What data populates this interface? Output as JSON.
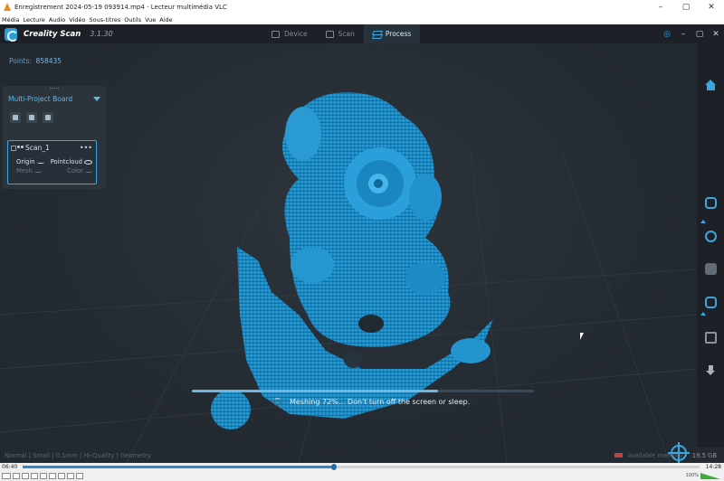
{
  "vlc": {
    "title": "Enregistrement 2024-05-19 093914.mp4 - Lecteur multimédia VLC",
    "menu": [
      "Média",
      "Lecture",
      "Audio",
      "Vidéo",
      "Sous-titres",
      "Outils",
      "Vue",
      "Aide"
    ],
    "time_current": "06:40",
    "time_total": "14:28",
    "seek_progress": 0.46,
    "volume": "100%"
  },
  "app": {
    "name": "Creality Scan",
    "version": "3.1.30",
    "tabs": [
      {
        "label": "Device",
        "active": false
      },
      {
        "label": "Scan",
        "active": false
      },
      {
        "label": "Process",
        "active": true
      }
    ],
    "accent_color": "#3aa7e0"
  },
  "viewport": {
    "points_label": "Points:",
    "points_value": "858435"
  },
  "panel": {
    "title": "Multi-Project Board",
    "scan": {
      "name": "Scan_1",
      "origin": "Origin",
      "pointcloud": "Pointcloud",
      "mesh": "Mesh",
      "color": "Color"
    }
  },
  "progress": {
    "message": "Meshing 72%... Don't turn off the screen or sleep.",
    "percent": 72
  },
  "status": {
    "settings": "Normal | Small | 0.1mm | Hi-Quality | Geometry",
    "memory_label": "Available memory",
    "memory_value": "19.5 GB"
  },
  "icons": {
    "right_toolbar": [
      "home-icon",
      "hand-scan-icon",
      "ear-scan-icon",
      "texture-icon",
      "crop-icon",
      "image-icon",
      "download-icon"
    ],
    "view_target": "target-icon"
  }
}
